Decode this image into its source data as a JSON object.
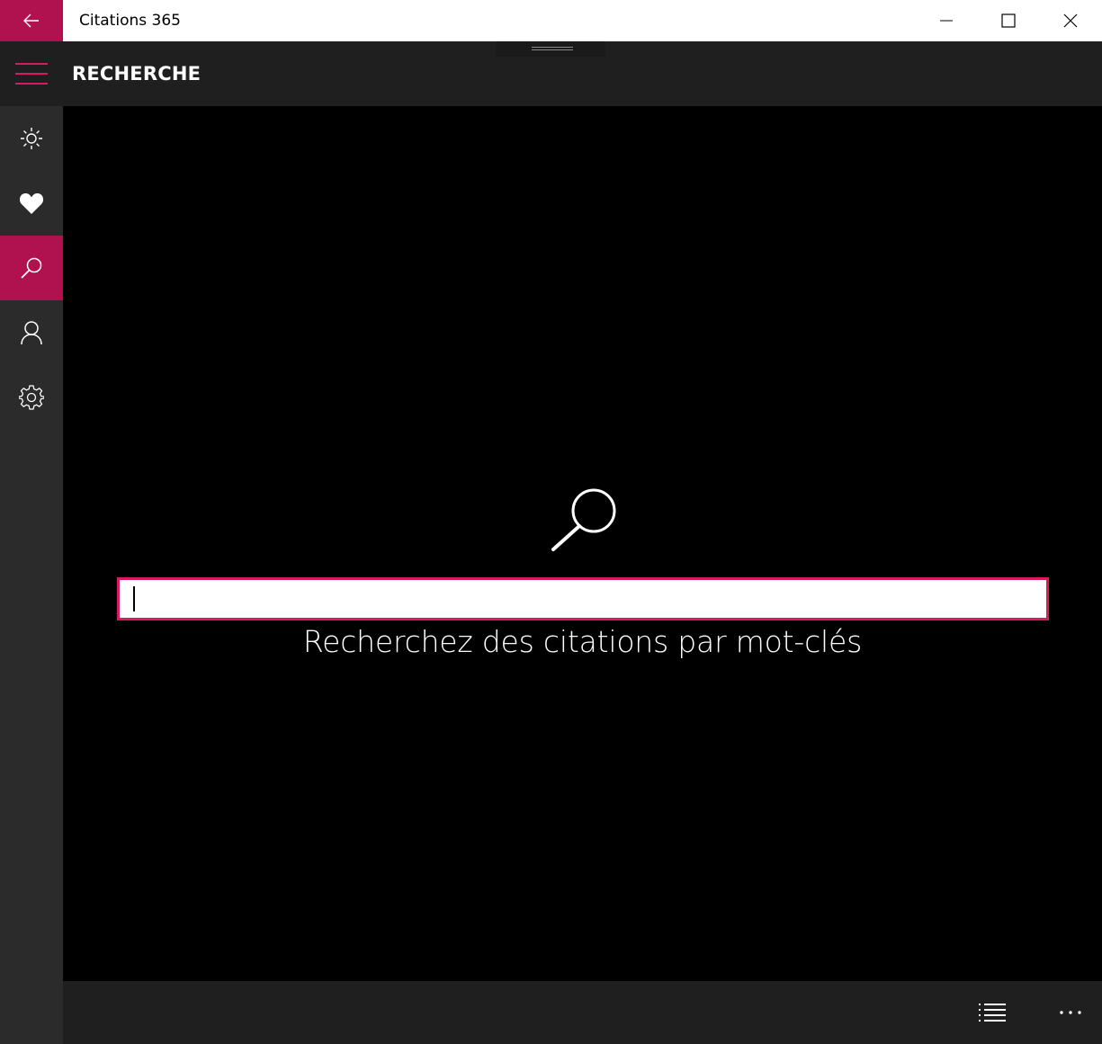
{
  "window": {
    "title": "Citations 365"
  },
  "header": {
    "title": "RECHERCHE"
  },
  "sidebar": {
    "items": [
      {
        "name": "today",
        "icon": "sun-icon"
      },
      {
        "name": "favorites",
        "icon": "heart-icon"
      },
      {
        "name": "search",
        "icon": "search-icon",
        "active": true
      },
      {
        "name": "authors",
        "icon": "person-icon"
      },
      {
        "name": "settings",
        "icon": "gear-icon"
      }
    ]
  },
  "search": {
    "value": "",
    "hint": "Recherchez des citations par mot-clés"
  },
  "colors": {
    "accent": "#b0124f",
    "input_border": "#d81b60",
    "chrome": "#1f1f1f",
    "sidebar": "#2b2b2b"
  }
}
